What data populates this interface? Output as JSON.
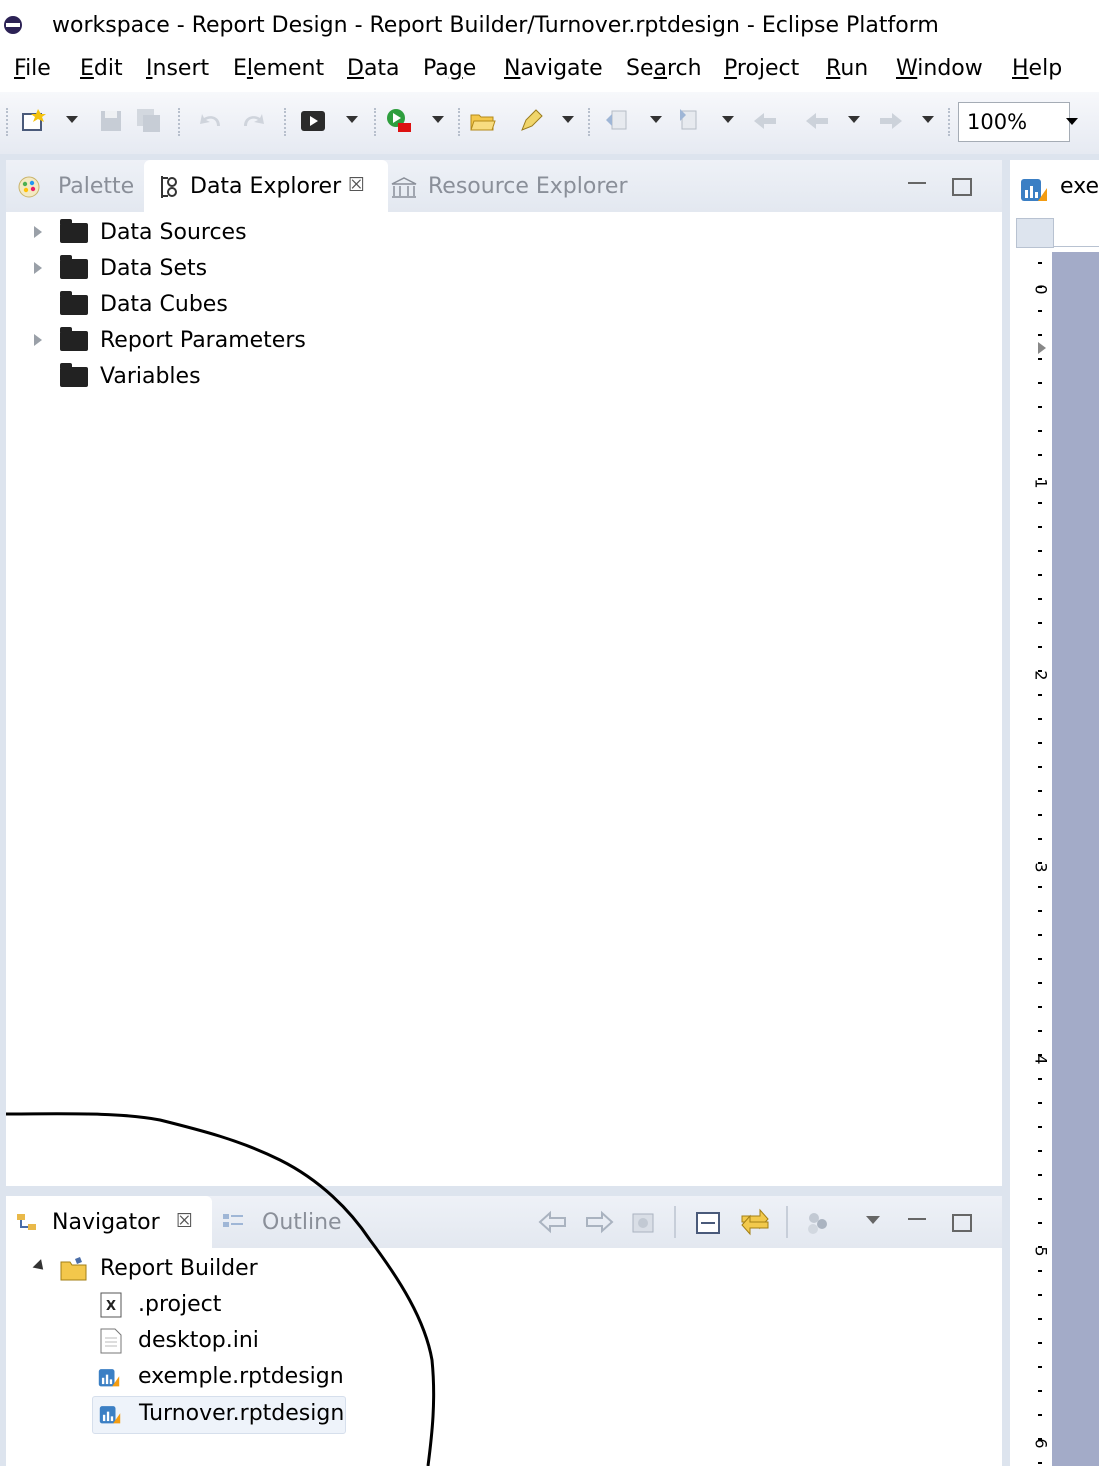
{
  "window": {
    "title": "workspace - Report Design - Report Builder/Turnover.rptdesign - Eclipse Platform"
  },
  "menu": [
    {
      "pre": "",
      "u": "F",
      "post": "ile"
    },
    {
      "pre": "",
      "u": "E",
      "post": "dit"
    },
    {
      "pre": "",
      "u": "I",
      "post": "nsert"
    },
    {
      "pre": "E",
      "u": "l",
      "post": "ement"
    },
    {
      "pre": "",
      "u": "D",
      "post": "ata"
    },
    {
      "pre": "Pa",
      "u": "g",
      "post": "e"
    },
    {
      "pre": "",
      "u": "N",
      "post": "avigate"
    },
    {
      "pre": "Se",
      "u": "a",
      "post": "rch"
    },
    {
      "pre": "",
      "u": "P",
      "post": "roject"
    },
    {
      "pre": "",
      "u": "R",
      "post": "un"
    },
    {
      "pre": "",
      "u": "W",
      "post": "indow"
    },
    {
      "pre": "",
      "u": "H",
      "post": "elp"
    }
  ],
  "toolbar": {
    "zoom": "100%"
  },
  "upper_view": {
    "tabs": {
      "palette": "Palette",
      "data_explorer": "Data Explorer",
      "resource_explorer": "Resource Explorer"
    },
    "tree": [
      {
        "label": "Data Sources",
        "expandable": true
      },
      {
        "label": "Data Sets",
        "expandable": true
      },
      {
        "label": "Data Cubes",
        "expandable": false
      },
      {
        "label": "Report Parameters",
        "expandable": true
      },
      {
        "label": "Variables",
        "expandable": false
      }
    ]
  },
  "lower_view": {
    "tabs": {
      "navigator": "Navigator",
      "outline": "Outline"
    },
    "project": "Report Builder",
    "files": [
      {
        "name": ".project",
        "icon": "xml-file-icon"
      },
      {
        "name": "desktop.ini",
        "icon": "text-file-icon"
      },
      {
        "name": "exemple.rptdesign",
        "icon": "report-design-icon"
      },
      {
        "name": "Turnover.rptdesign",
        "icon": "report-design-icon",
        "selected": true
      }
    ]
  },
  "editor": {
    "tab_label": "exer",
    "ruler_numbers": [
      "0",
      "1",
      "2",
      "3",
      "4",
      "5",
      "6"
    ]
  },
  "colors": {
    "toolbar_bg": "#e6eaf2",
    "view_bg": "#dde4ee",
    "page_area": "#a3abc8",
    "selection": "#e5f0fb"
  }
}
